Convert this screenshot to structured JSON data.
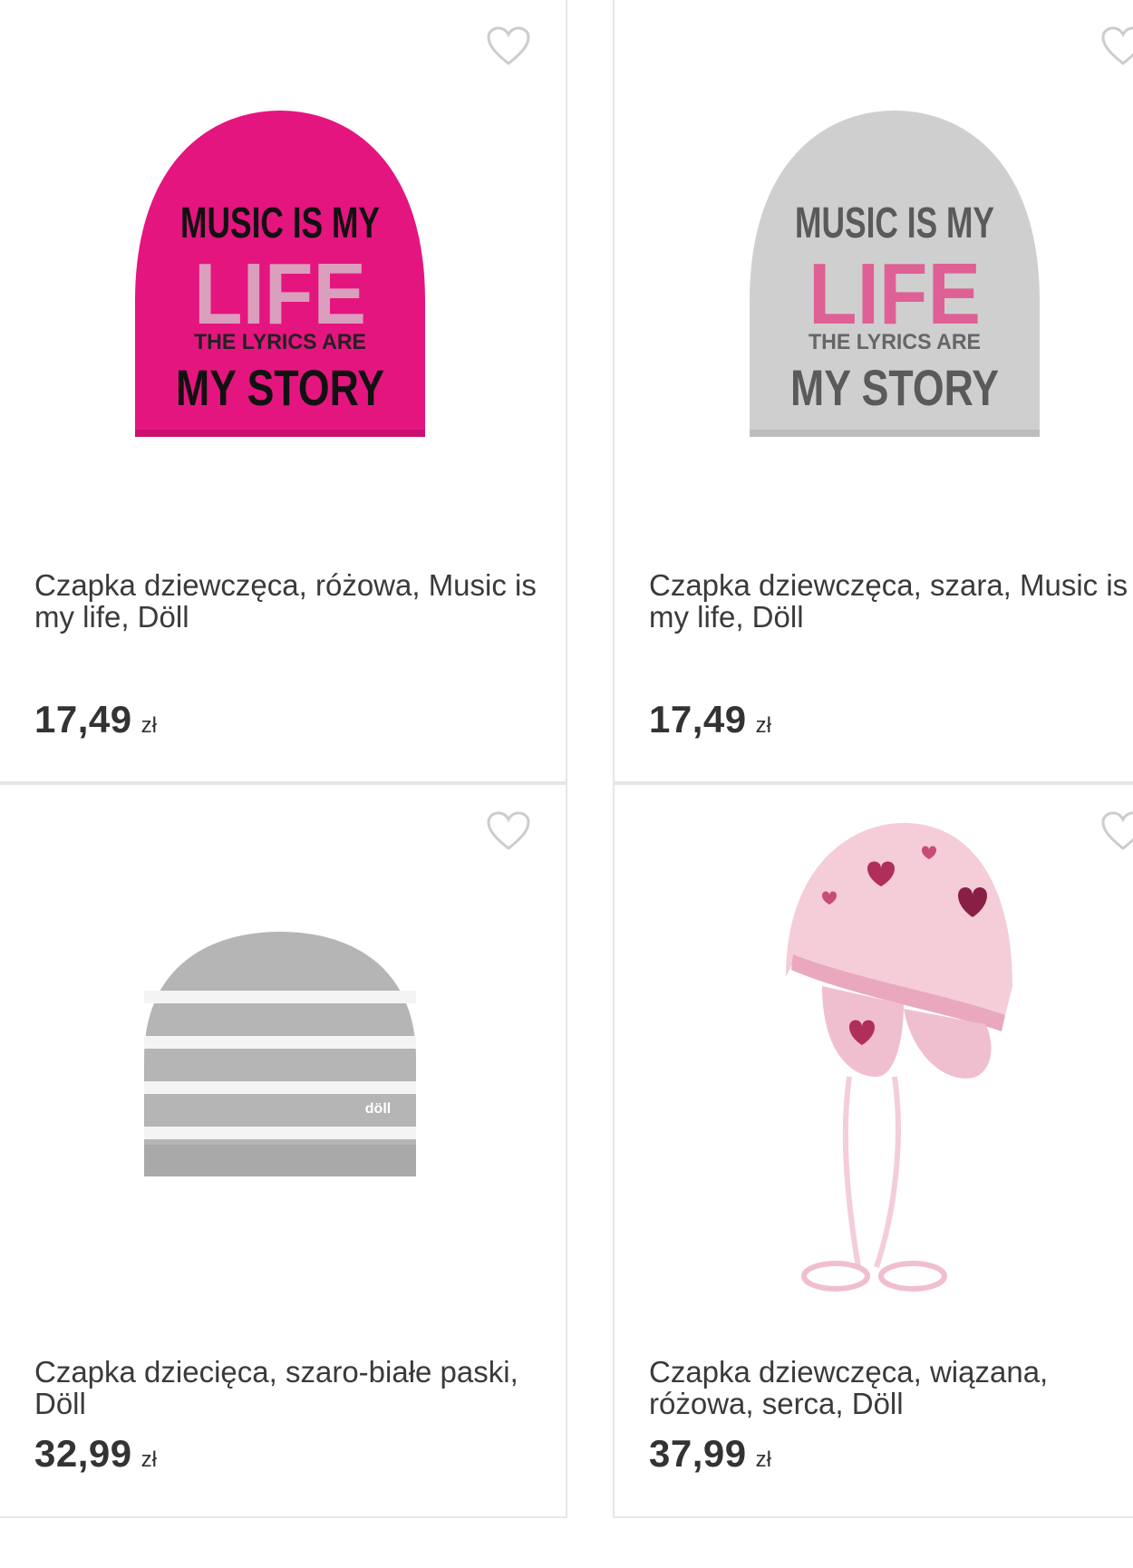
{
  "products": [
    {
      "title": "Czapka dziewczęca, różowa, Music is my life, Döll",
      "price": "17,49",
      "currency": "zł",
      "hat_color": "#e5157f",
      "print_lines": [
        "MUSIC IS MY",
        "LIFE",
        "THE LYRICS ARE",
        "MY STORY"
      ]
    },
    {
      "title": "Czapka dziewczęca, szara, Music is my life, Döll",
      "price": "17,49",
      "currency": "zł",
      "hat_color": "#cfcfcf",
      "print_lines": [
        "MUSIC IS MY",
        "LIFE",
        "THE LYRICS ARE",
        "MY STORY"
      ]
    },
    {
      "title": "Czapka dziecięca, szaro-białe paski, Döll",
      "price": "32,99",
      "currency": "zł",
      "hat_color": "#b5b5b5",
      "label_text": "döll"
    },
    {
      "title": "Czapka dziewczęca, wiązana, różowa, serca, Döll",
      "price": "37,99",
      "currency": "zł",
      "hat_color": "#f4cdd9"
    }
  ],
  "icons": {
    "favorite": "heart-outline-icon"
  },
  "colors": {
    "border": "#e6e6e6",
    "text": "#3a3a3a",
    "icon": "#cccccc"
  }
}
